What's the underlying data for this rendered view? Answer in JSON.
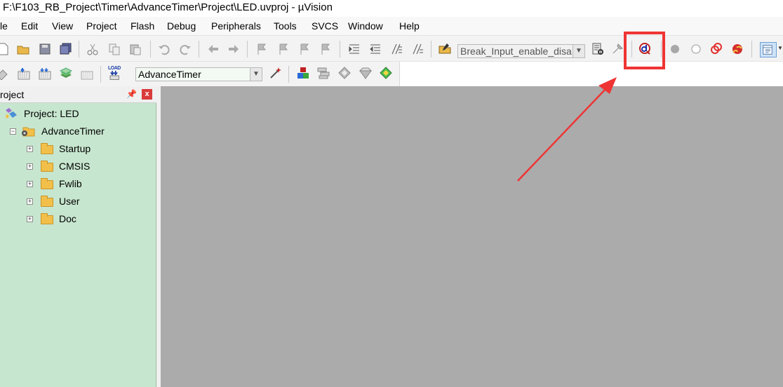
{
  "window": {
    "title": "F:\\F103_RB_Project\\Timer\\AdvanceTimer\\Project\\LED.uvproj - µVision"
  },
  "menu": {
    "items": [
      "le",
      "Edit",
      "View",
      "Project",
      "Flash",
      "Debug",
      "Peripherals",
      "Tools",
      "SVCS",
      "Window",
      "Help"
    ]
  },
  "toolbar1": {
    "find_combo_value": "Break_Input_enable_disa",
    "icons": [
      "new-file-icon",
      "open-folder-icon",
      "save-icon",
      "save-all-icon",
      "cut-icon",
      "copy-icon",
      "paste-icon",
      "undo-icon",
      "redo-icon",
      "navigate-back-icon",
      "navigate-forward-icon",
      "bookmark-icon",
      "bookmark-prev-icon",
      "bookmark-next-icon",
      "bookmark-clear-icon",
      "indent-icon",
      "unindent-icon",
      "comment-icon",
      "uncomment-icon",
      "find-in-files-icon",
      "incremental-find-icon",
      "debug-session-icon",
      "breakpoint-insert-icon",
      "breakpoint-enable-icon",
      "breakpoint-disable-all-icon",
      "breakpoint-kill-all-icon",
      "window-layout-icon"
    ]
  },
  "toolbar2": {
    "target_combo_value": "AdvanceTimer",
    "load_label": "LOAD"
  },
  "project_panel": {
    "title": "roject",
    "pin_glyph": "←",
    "close_glyph": "x",
    "root": "Project: LED",
    "target": "AdvanceTimer",
    "groups": [
      {
        "label": "Startup"
      },
      {
        "label": "CMSIS"
      },
      {
        "label": "Fwlib"
      },
      {
        "label": "User"
      },
      {
        "label": "Doc"
      }
    ]
  },
  "colors": {
    "panel_bg": "#c7e6cf",
    "editor_bg": "#ababab",
    "annotation_red": "#ef3434"
  }
}
